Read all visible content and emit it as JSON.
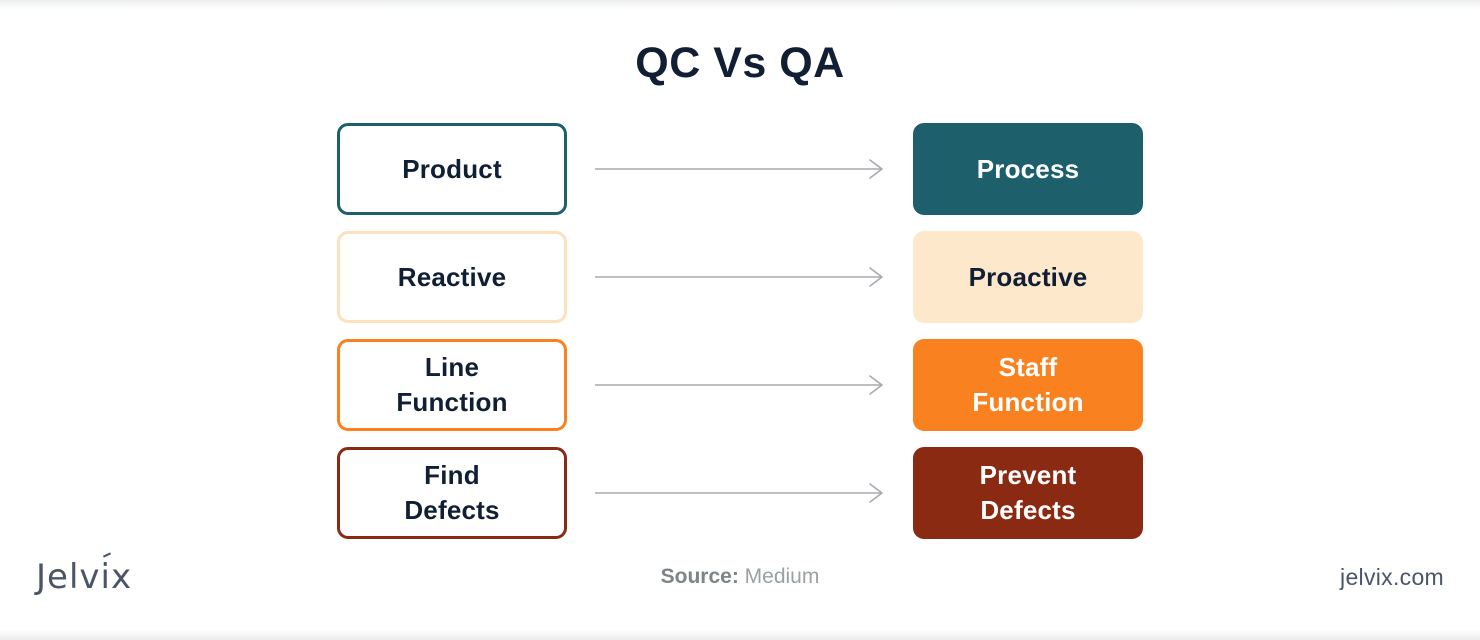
{
  "title": "QC Vs QA",
  "colors": {
    "title_text": "#101f33",
    "teal": "#1d5f6b",
    "cream": "#fde8cb",
    "orange": "#f9811f",
    "maroon": "#8b2a12",
    "dark_text": "#101f33",
    "light_text": "#ffffff",
    "arrow": "#a7aaad",
    "logo": "#4a5568"
  },
  "rows": [
    {
      "left": {
        "label": "Product",
        "border_color": "#1d5f6b",
        "bg": "#ffffff",
        "text_color": "#101f33"
      },
      "right": {
        "label": "Process",
        "bg": "#1d5f6b",
        "text_color": "#ffffff"
      },
      "arrow": "arrow-right-icon"
    },
    {
      "left": {
        "label": "Reactive",
        "border_color": "#fde0bd",
        "bg": "#ffffff",
        "text_color": "#101f33"
      },
      "right": {
        "label": "Proactive",
        "bg": "#fde8cb",
        "text_color": "#101f33"
      },
      "arrow": "arrow-right-icon"
    },
    {
      "left": {
        "label": "Line\nFunction",
        "border_color": "#f9811f",
        "bg": "#ffffff",
        "text_color": "#101f33"
      },
      "right": {
        "label": "Staff\nFunction",
        "bg": "#f9811f",
        "text_color": "#ffffff"
      },
      "arrow": "arrow-right-icon"
    },
    {
      "left": {
        "label": "Find\nDefects",
        "border_color": "#8b2a12",
        "bg": "#ffffff",
        "text_color": "#101f33"
      },
      "right": {
        "label": "Prevent\nDefects",
        "bg": "#8b2a12",
        "text_color": "#ffffff"
      },
      "arrow": "arrow-right-icon"
    }
  ],
  "footer": {
    "source_label": "Source:",
    "source_value": "Medium",
    "logo_text": "Jelvix",
    "website": "jelvix.com"
  }
}
